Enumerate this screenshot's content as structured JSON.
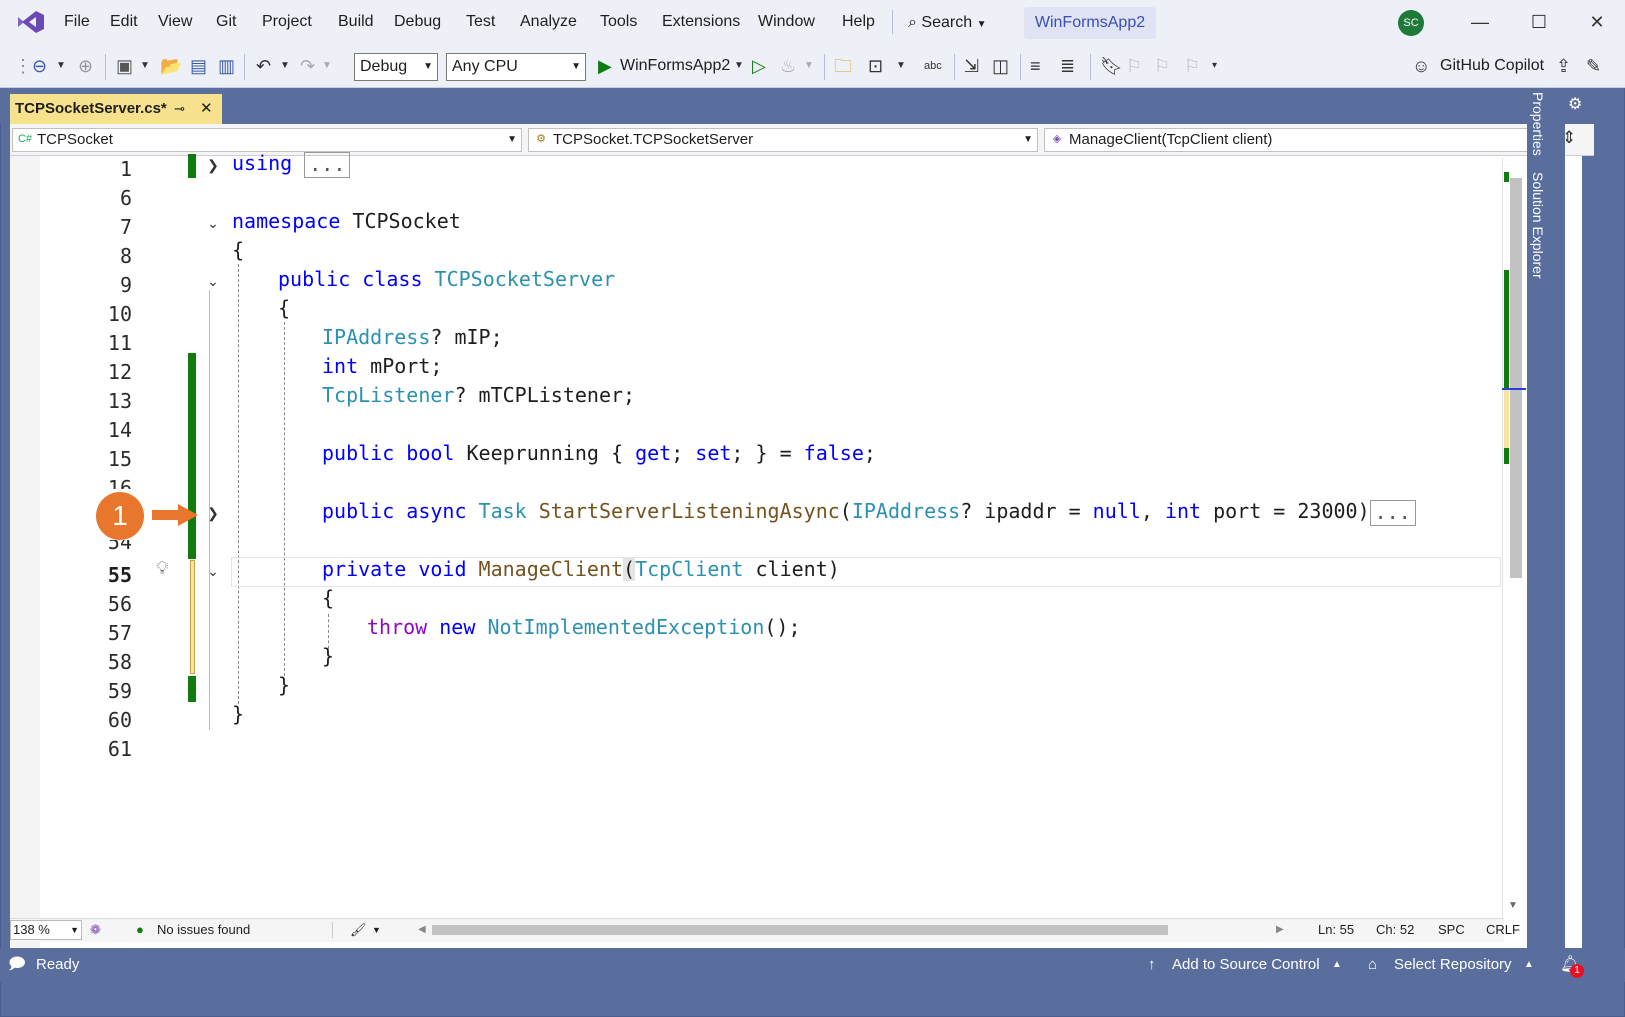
{
  "menu": [
    "File",
    "Edit",
    "View",
    "Git",
    "Project",
    "Build",
    "Debug",
    "Test",
    "Analyze",
    "Tools",
    "Extensions",
    "Window",
    "Help"
  ],
  "search_label": "Search",
  "solution_name": "WinFormsApp2",
  "avatar_initials": "SC",
  "toolbar": {
    "config": "Debug",
    "platform": "Any CPU",
    "run_target": "WinFormsApp2",
    "copilot": "GitHub Copilot"
  },
  "tab": {
    "title": "TCPSocketServer.cs*"
  },
  "nav": {
    "project": "TCPSocket",
    "type": "TCPSocket.TCPSocketServer",
    "member": "ManageClient(TcpClient client)"
  },
  "line_numbers": [
    "1",
    "6",
    "7",
    "8",
    "9",
    "10",
    "11",
    "12",
    "13",
    "14",
    "15",
    "16",
    "17",
    "54",
    "55",
    "56",
    "57",
    "58",
    "59",
    "60",
    "61"
  ],
  "code": {
    "l1_kw": "using",
    "l1_box": "...",
    "l7_kw": "namespace",
    "l7_name": "TCPSocket",
    "l8": "{",
    "l9_kw": "public class",
    "l9_type": "TCPSocketServer",
    "l10": "{",
    "l11_type": "IPAddress",
    "l11_rest": "? mIP;",
    "l12_kw": "int",
    "l12_rest": " mPort;",
    "l13_type": "TcpListener",
    "l13_rest": "? mTCPListener;",
    "l15_kw1": "public bool",
    "l15_name": " Keeprunning { ",
    "l15_get": "get",
    "l15_semi": "; ",
    "l15_set": "set",
    "l15_end": "; } = ",
    "l15_false": "false",
    "l15_tail": ";",
    "l17_kw": "public async",
    "l17_task": "Task",
    "l17_fn": "StartServerListeningAsync",
    "l17_p1": "(",
    "l17_ip": "IPAddress",
    "l17_p2": "? ipaddr = ",
    "l17_null": "null",
    "l17_p3": ", ",
    "l17_int": "int",
    "l17_p4": " port = 23000)",
    "l17_box": "...",
    "l55_kw": "private void",
    "l55_fn": "ManageClient",
    "l55_p": "(",
    "l55_type": "TcpClient",
    "l55_rest": " client)",
    "l56": "{",
    "l57_throw": "throw",
    "l57_new": "new",
    "l57_type": "NotImplementedException",
    "l57_rest": "();",
    "l58": "}",
    "l59": "}",
    "l60": "}"
  },
  "bottom": {
    "zoom": "138 %",
    "issues": "No issues found",
    "ln": "Ln: 55",
    "ch": "Ch: 52",
    "spc": "SPC",
    "crlf": "CRLF"
  },
  "status": {
    "ready": "Ready",
    "source_control": "Add to Source Control",
    "repository": "Select Repository",
    "notif_count": "1"
  },
  "side": {
    "properties": "Properties",
    "solution_explorer": "Solution Explorer"
  },
  "callout": "1",
  "colors": {
    "accent_orange": "#e8762d",
    "frame": "#5a6e9e",
    "keyword": "#0000ff",
    "type": "#2b91af",
    "control": "#8f08c4"
  }
}
